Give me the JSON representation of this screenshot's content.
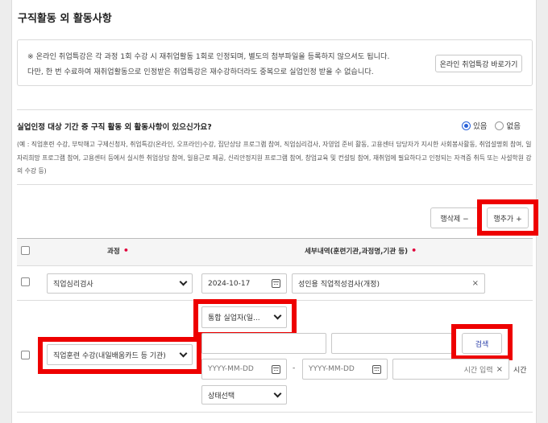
{
  "section": {
    "title": "구직활동 외 활동사항"
  },
  "notice": {
    "line1": "※ 온라인 취업특강은 각 과정 1회 수강 시 재취업활동 1회로 인정되며, 별도의 첨부파일을 등록하지 않으셔도 됩니다.",
    "line2": "다만, 한 번 수료하여 재취업활동으로 인정받은 취업특강은 재수강하더라도 중복으로 실업인정 받을 수 없습니다.",
    "link_button": "온라인 취업특강 바로가기"
  },
  "question": {
    "text": "실업인정 대상 기간 중 구직 활동 외 활동사항이 있으신가요?",
    "option_yes": "있음",
    "option_no": "없음",
    "selected": "있음"
  },
  "example": {
    "text": "(예 : 직업훈련 수강, 부탁해고 구제신청자, 취업특강(온라인, 오프라인)수강, 집단상담 프로그램 참여, 직업심리검사, 자영업 준비 활동, 고용센터 담당자가 지시한 사회봉사활동, 취업설명회 참여, 일자리희망 프로그램 참여, 고용센터 등에서 실시한 취업상담 참여, 일용근로 제공, 신리안정지원 프로그램 참여, 창업교육 및 컨설팅 참여, 재취업에 필요하다고 인정되는 자격증 취득 또는 사설학원 강의 수강 등)"
  },
  "toolbar": {
    "delete_row": "행삭제 −",
    "add_row": "행추가 +"
  },
  "table": {
    "col_course": "과정",
    "col_detail": "세부내역(훈련기관,과정명,기관 등)",
    "required_mark": "•",
    "row1": {
      "course": "직업심리검사",
      "date": "2024-10-17",
      "detail": "성인용 직업적성검사(개정)"
    },
    "row2": {
      "type_select": "통합 실업자(일...",
      "course": "직업훈련 수강(내일배움카드 등 기관)",
      "search_button": "검색",
      "date_start_placeholder": "YYYY-MM-DD",
      "date_separator": "-",
      "date_end_placeholder": "YYYY-MM-DD",
      "time_placeholder": "시간 입력",
      "time_unit": "시간",
      "status_select": "상태선택"
    }
  },
  "colors": {
    "highlight": "#ee0000",
    "radio_selected": "#2a62d9",
    "required": "#e0003a"
  }
}
